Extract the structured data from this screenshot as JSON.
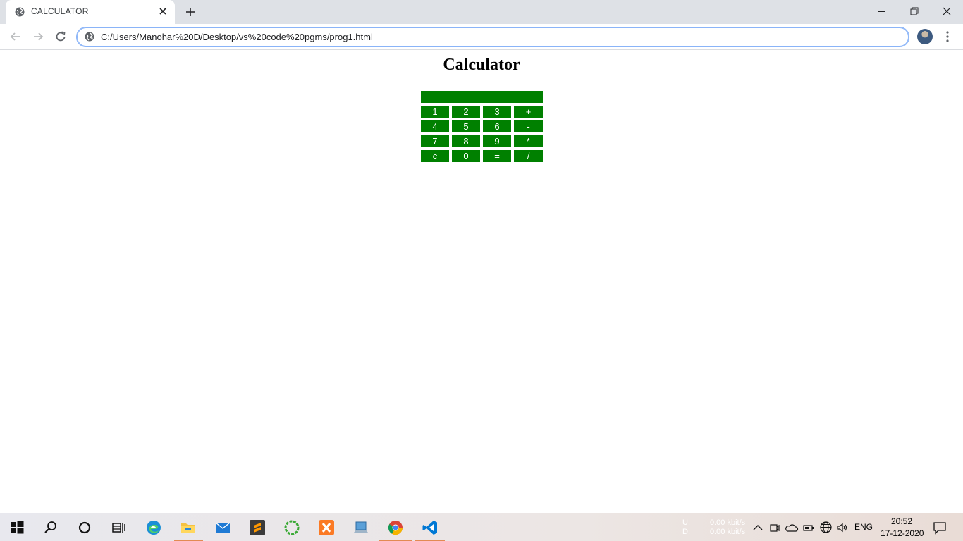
{
  "browser": {
    "tab_title": "CALCULATOR",
    "url": "C:/Users/Manohar%20D/Desktop/vs%20code%20pgms/prog1.html"
  },
  "page": {
    "heading": "Calculator",
    "display_value": "",
    "keys": [
      [
        "1",
        "2",
        "3",
        "+"
      ],
      [
        "4",
        "5",
        "6",
        "-"
      ],
      [
        "7",
        "8",
        "9",
        "*"
      ],
      [
        "c",
        "0",
        "=",
        "/"
      ]
    ],
    "key_color": "#008000"
  },
  "taskbar": {
    "net_up_label": "U:",
    "net_down_label": "D:",
    "net_up": "0.00 kbit/s",
    "net_down": "0.00 kbit/s",
    "language": "ENG",
    "time": "20:52",
    "date": "17-12-2020",
    "apps": [
      "windows-start",
      "search",
      "cortana",
      "task-view",
      "edge",
      "file-explorer",
      "mail",
      "sublime-text",
      "green-app",
      "xampp",
      "laptop-app",
      "chrome",
      "vscode"
    ]
  }
}
